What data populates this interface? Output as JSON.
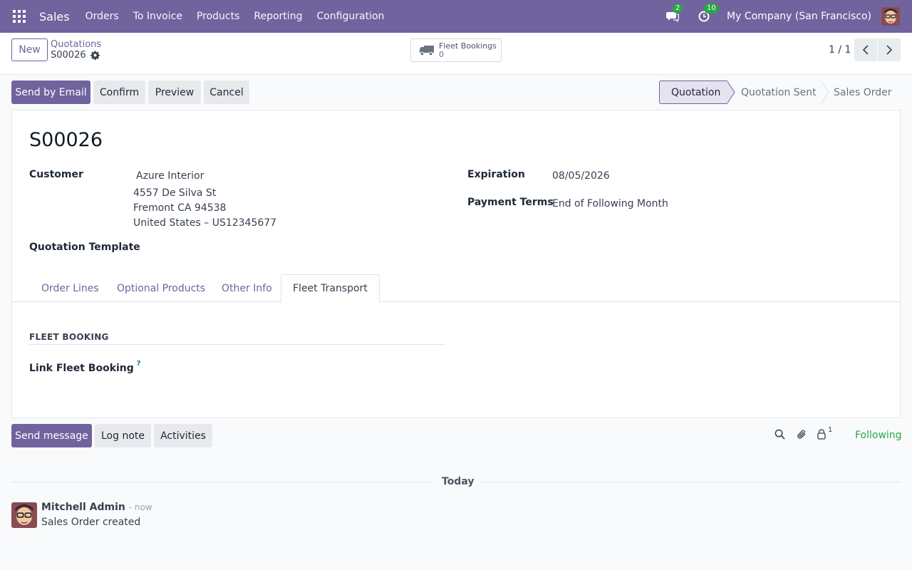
{
  "navbar": {
    "app_name": "Sales",
    "menu": [
      "Orders",
      "To Invoice",
      "Products",
      "Reporting",
      "Configuration"
    ],
    "messages_count": "2",
    "activities_count": "10",
    "company": "My Company (San Francisco)"
  },
  "control": {
    "new_label": "New",
    "breadcrumb_parent": "Quotations",
    "breadcrumb_current": "S00026",
    "smart_button_label": "Fleet Bookings",
    "smart_button_value": "0",
    "pager": "1 / 1"
  },
  "actions": {
    "send_email": "Send by Email",
    "confirm": "Confirm",
    "preview": "Preview",
    "cancel": "Cancel"
  },
  "status": {
    "steps": [
      "Quotation",
      "Quotation Sent",
      "Sales Order"
    ],
    "active": "Quotation"
  },
  "form": {
    "name": "S00026",
    "customer_label": "Customer",
    "customer_name": "Azure Interior",
    "address_line1": "4557 De Silva St",
    "address_line2": "Fremont CA 94538",
    "address_line3": "United States – US12345677",
    "template_label": "Quotation Template",
    "expiration_label": "Expiration",
    "expiration_value": "08/05/2026",
    "payment_terms_label": "Payment Terms",
    "payment_terms_value": "End of Following Month"
  },
  "tabs": [
    "Order Lines",
    "Optional Products",
    "Other Info",
    "Fleet Transport"
  ],
  "fleet": {
    "section_title": "FLEET BOOKING",
    "link_label": "Link Fleet Booking",
    "help": "?"
  },
  "chatter": {
    "send_message": "Send message",
    "log_note": "Log note",
    "activities": "Activities",
    "followers_count": "1",
    "following": "Following",
    "today": "Today",
    "author": "Mitchell Admin",
    "time": "- now",
    "body": "Sales Order created"
  },
  "colors": {
    "brand": "#71639e",
    "success": "#28a745"
  }
}
